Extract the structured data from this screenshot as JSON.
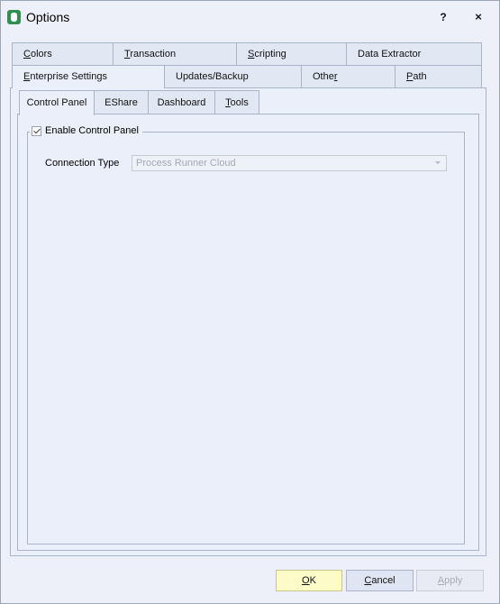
{
  "window": {
    "title": "Options",
    "help_label": "?",
    "close_label": "×",
    "app_icon": "database-icon"
  },
  "tabs_row1": [
    {
      "label": "Colors",
      "accel": "C"
    },
    {
      "label": "Transaction",
      "accel": "T"
    },
    {
      "label": "Scripting",
      "accel": "S"
    },
    {
      "label": "Data Extractor",
      "accel": ""
    }
  ],
  "tabs_row2": [
    {
      "label": "Enterprise Settings",
      "accel": "E"
    },
    {
      "label": "Updates/Backup",
      "accel": ""
    },
    {
      "label": "Other",
      "accel": "r"
    },
    {
      "label": "Path",
      "accel": "P"
    }
  ],
  "active_tab": "Enterprise Settings",
  "subtabs": [
    {
      "label": "Control Panel"
    },
    {
      "label": "EShare"
    },
    {
      "label": "Dashboard"
    },
    {
      "label": "Tools",
      "accel": "T"
    }
  ],
  "active_subtab": "Control Panel",
  "control_panel": {
    "enable_label": "Enable Control Panel",
    "enable_checked": true,
    "connection_type_label": "Connection Type",
    "connection_type_value": "Process Runner Cloud"
  },
  "buttons": {
    "ok": "OK",
    "cancel": "Cancel",
    "apply": "Apply"
  },
  "colors": {
    "ok_background": "#fdfbc8",
    "window_background": "#eef0f9"
  }
}
